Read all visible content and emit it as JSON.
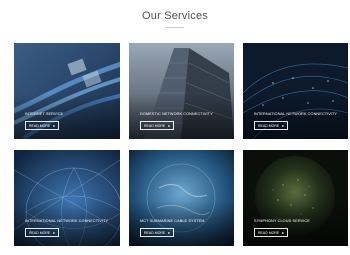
{
  "section": {
    "title": "Our Services"
  },
  "services": [
    {
      "title": "INTERNET SERVICE",
      "button_label": "READ MORE",
      "icon": "ethernet-cables-image"
    },
    {
      "title": "DOMESTIC NETWORK CONNECTIVITY",
      "button_label": "READ MORE",
      "icon": "office-tower-image"
    },
    {
      "title": "INTERNATIONAL NETWORK CONNECTIVITY",
      "button_label": "READ MORE",
      "icon": "world-light-network-image"
    },
    {
      "title": "INTERNATIONAL NETWORK CONNECTIVITY",
      "button_label": "READ MORE",
      "icon": "globe-network-image"
    },
    {
      "title": "MCT SUBMARINE CABLE SYSTEM",
      "button_label": "READ MORE",
      "icon": "earth-glow-image"
    },
    {
      "title": "SYMPHONY CLOUD SERVICE",
      "button_label": "READ MORE",
      "icon": "dark-globe-image"
    }
  ]
}
